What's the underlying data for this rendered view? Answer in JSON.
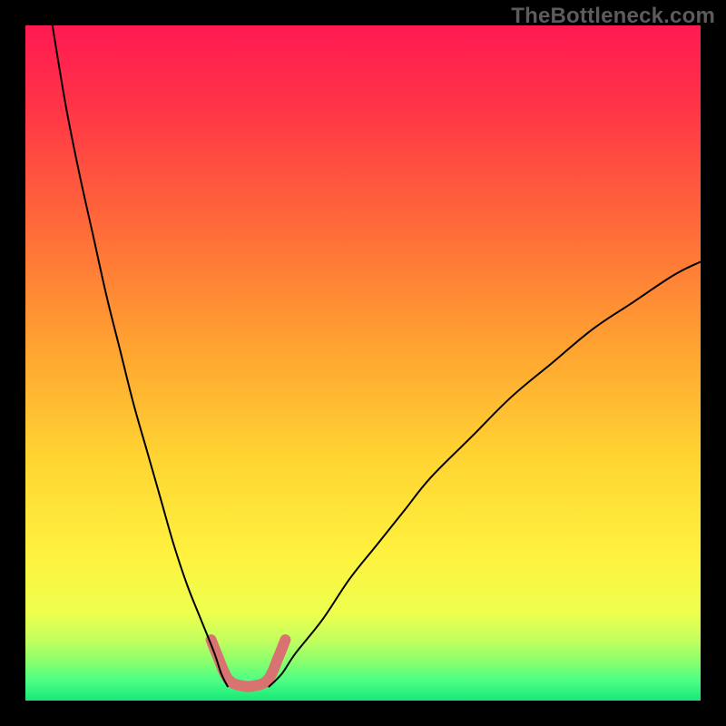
{
  "watermark": "TheBottleneck.com",
  "chart_data": {
    "type": "line",
    "title": "",
    "xlabel": "",
    "ylabel": "",
    "xlim": [
      0,
      100
    ],
    "ylim": [
      0,
      100
    ],
    "grid": false,
    "legend": false,
    "annotations": [],
    "gradient_stops": [
      {
        "offset": 0.0,
        "color": "#ff1a52"
      },
      {
        "offset": 0.12,
        "color": "#ff3447"
      },
      {
        "offset": 0.3,
        "color": "#ff6b39"
      },
      {
        "offset": 0.48,
        "color": "#ffa431"
      },
      {
        "offset": 0.64,
        "color": "#ffd432"
      },
      {
        "offset": 0.78,
        "color": "#fff13e"
      },
      {
        "offset": 0.87,
        "color": "#eeff4e"
      },
      {
        "offset": 0.91,
        "color": "#c3ff5e"
      },
      {
        "offset": 0.94,
        "color": "#8eff6c"
      },
      {
        "offset": 0.97,
        "color": "#4cff84"
      },
      {
        "offset": 1.0,
        "color": "#17e87a"
      }
    ],
    "series": [
      {
        "name": "bottleneck-curve-left",
        "x": [
          4,
          6,
          8,
          10,
          12,
          14,
          16,
          18,
          20,
          22,
          24,
          26,
          28,
          29,
          30
        ],
        "y": [
          100,
          88,
          78,
          69,
          60,
          52,
          44,
          37,
          30,
          23,
          17,
          12,
          7,
          4,
          2
        ],
        "stroke": "#000000",
        "width": 2
      },
      {
        "name": "bottleneck-curve-right",
        "x": [
          36,
          38,
          40,
          44,
          48,
          52,
          56,
          60,
          66,
          72,
          78,
          84,
          90,
          96,
          100
        ],
        "y": [
          2,
          4,
          7,
          12,
          18,
          23,
          28,
          33,
          39,
          45,
          50,
          55,
          59,
          63,
          65
        ],
        "stroke": "#000000",
        "width": 2
      },
      {
        "name": "highlight-band",
        "x": [
          27.5,
          28.5,
          30,
          32,
          34,
          36,
          37.5,
          38.5
        ],
        "y": [
          9,
          6.5,
          3.2,
          2.2,
          2.2,
          3.2,
          6.5,
          9
        ],
        "stroke": "#d9736f",
        "width": 12,
        "linecap": "round"
      }
    ]
  }
}
